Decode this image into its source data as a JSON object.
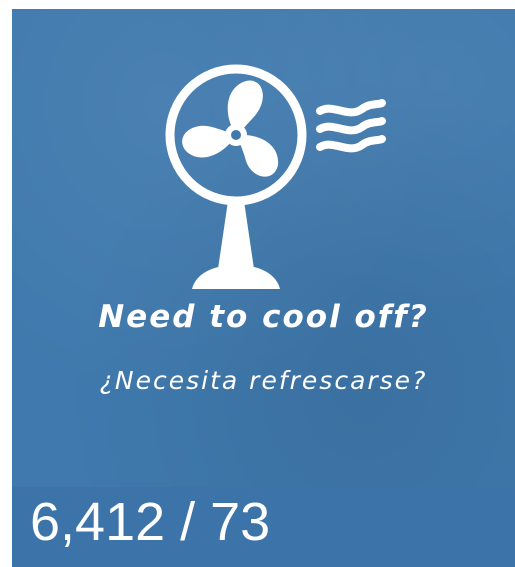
{
  "poster": {
    "headline_en": "Need to cool off?",
    "headline_es": "¿Necesita refrescarse?",
    "icon": "fan-icon",
    "background_color": "#3f79ad"
  },
  "stats": {
    "text": "6,412 / 73",
    "bar_color": "#3c74a9"
  }
}
